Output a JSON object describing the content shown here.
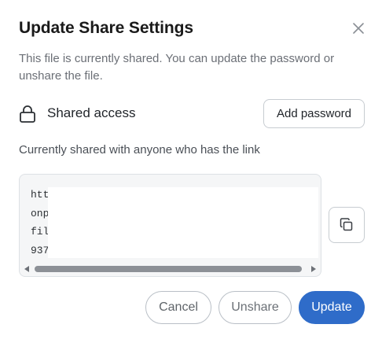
{
  "dialog": {
    "title": "Update Share Settings",
    "description": "This file is currently shared. You can update the password or unshare the file.",
    "access": {
      "label": "Shared access",
      "add_password_label": "Add password",
      "lock_icon": "lock-icon"
    },
    "shared_with_text": "Currently shared with anyone who has the link",
    "link": {
      "lines": [
        "htt",
        "onp",
        "fil",
        "937"
      ]
    },
    "copy_icon": "copy-icon",
    "close_icon": "close-icon",
    "footer": {
      "cancel_label": "Cancel",
      "unshare_label": "Unshare",
      "update_label": "Update"
    }
  },
  "colors": {
    "primary": "#2f6cc9",
    "muted_text": "#6b6f76",
    "border": "#c7ccd1"
  }
}
